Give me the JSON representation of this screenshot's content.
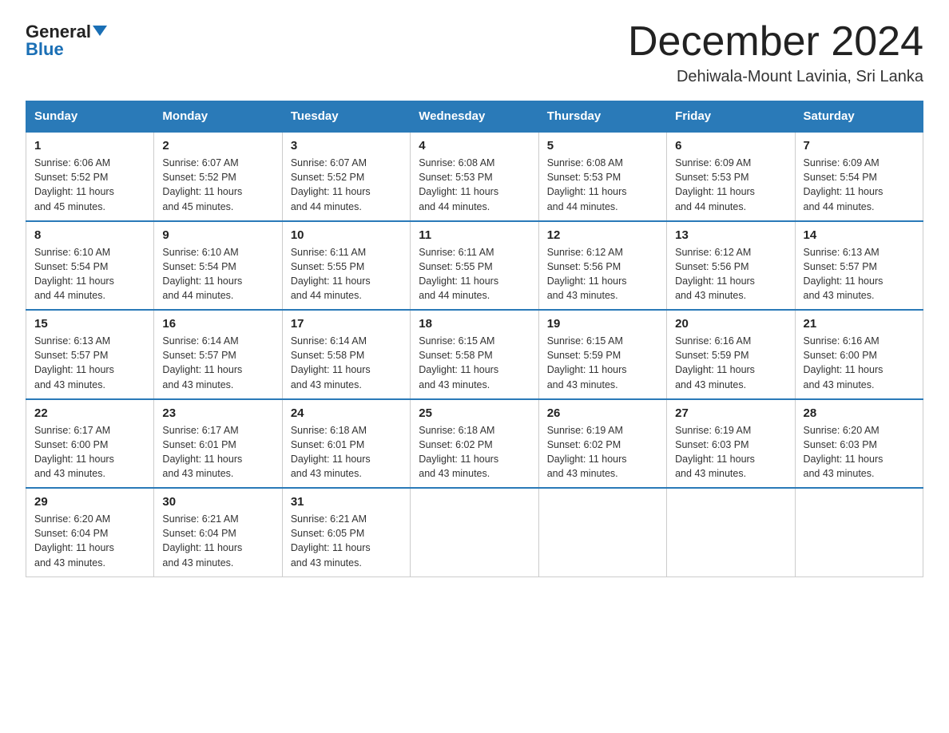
{
  "logo": {
    "text_general": "General",
    "text_blue": "Blue"
  },
  "title": {
    "month_year": "December 2024",
    "location": "Dehiwala-Mount Lavinia, Sri Lanka"
  },
  "days_of_week": [
    "Sunday",
    "Monday",
    "Tuesday",
    "Wednesday",
    "Thursday",
    "Friday",
    "Saturday"
  ],
  "weeks": [
    [
      {
        "day": "1",
        "sunrise": "6:06 AM",
        "sunset": "5:52 PM",
        "daylight": "11 hours and 45 minutes."
      },
      {
        "day": "2",
        "sunrise": "6:07 AM",
        "sunset": "5:52 PM",
        "daylight": "11 hours and 45 minutes."
      },
      {
        "day": "3",
        "sunrise": "6:07 AM",
        "sunset": "5:52 PM",
        "daylight": "11 hours and 44 minutes."
      },
      {
        "day": "4",
        "sunrise": "6:08 AM",
        "sunset": "5:53 PM",
        "daylight": "11 hours and 44 minutes."
      },
      {
        "day": "5",
        "sunrise": "6:08 AM",
        "sunset": "5:53 PM",
        "daylight": "11 hours and 44 minutes."
      },
      {
        "day": "6",
        "sunrise": "6:09 AM",
        "sunset": "5:53 PM",
        "daylight": "11 hours and 44 minutes."
      },
      {
        "day": "7",
        "sunrise": "6:09 AM",
        "sunset": "5:54 PM",
        "daylight": "11 hours and 44 minutes."
      }
    ],
    [
      {
        "day": "8",
        "sunrise": "6:10 AM",
        "sunset": "5:54 PM",
        "daylight": "11 hours and 44 minutes."
      },
      {
        "day": "9",
        "sunrise": "6:10 AM",
        "sunset": "5:54 PM",
        "daylight": "11 hours and 44 minutes."
      },
      {
        "day": "10",
        "sunrise": "6:11 AM",
        "sunset": "5:55 PM",
        "daylight": "11 hours and 44 minutes."
      },
      {
        "day": "11",
        "sunrise": "6:11 AM",
        "sunset": "5:55 PM",
        "daylight": "11 hours and 44 minutes."
      },
      {
        "day": "12",
        "sunrise": "6:12 AM",
        "sunset": "5:56 PM",
        "daylight": "11 hours and 43 minutes."
      },
      {
        "day": "13",
        "sunrise": "6:12 AM",
        "sunset": "5:56 PM",
        "daylight": "11 hours and 43 minutes."
      },
      {
        "day": "14",
        "sunrise": "6:13 AM",
        "sunset": "5:57 PM",
        "daylight": "11 hours and 43 minutes."
      }
    ],
    [
      {
        "day": "15",
        "sunrise": "6:13 AM",
        "sunset": "5:57 PM",
        "daylight": "11 hours and 43 minutes."
      },
      {
        "day": "16",
        "sunrise": "6:14 AM",
        "sunset": "5:57 PM",
        "daylight": "11 hours and 43 minutes."
      },
      {
        "day": "17",
        "sunrise": "6:14 AM",
        "sunset": "5:58 PM",
        "daylight": "11 hours and 43 minutes."
      },
      {
        "day": "18",
        "sunrise": "6:15 AM",
        "sunset": "5:58 PM",
        "daylight": "11 hours and 43 minutes."
      },
      {
        "day": "19",
        "sunrise": "6:15 AM",
        "sunset": "5:59 PM",
        "daylight": "11 hours and 43 minutes."
      },
      {
        "day": "20",
        "sunrise": "6:16 AM",
        "sunset": "5:59 PM",
        "daylight": "11 hours and 43 minutes."
      },
      {
        "day": "21",
        "sunrise": "6:16 AM",
        "sunset": "6:00 PM",
        "daylight": "11 hours and 43 minutes."
      }
    ],
    [
      {
        "day": "22",
        "sunrise": "6:17 AM",
        "sunset": "6:00 PM",
        "daylight": "11 hours and 43 minutes."
      },
      {
        "day": "23",
        "sunrise": "6:17 AM",
        "sunset": "6:01 PM",
        "daylight": "11 hours and 43 minutes."
      },
      {
        "day": "24",
        "sunrise": "6:18 AM",
        "sunset": "6:01 PM",
        "daylight": "11 hours and 43 minutes."
      },
      {
        "day": "25",
        "sunrise": "6:18 AM",
        "sunset": "6:02 PM",
        "daylight": "11 hours and 43 minutes."
      },
      {
        "day": "26",
        "sunrise": "6:19 AM",
        "sunset": "6:02 PM",
        "daylight": "11 hours and 43 minutes."
      },
      {
        "day": "27",
        "sunrise": "6:19 AM",
        "sunset": "6:03 PM",
        "daylight": "11 hours and 43 minutes."
      },
      {
        "day": "28",
        "sunrise": "6:20 AM",
        "sunset": "6:03 PM",
        "daylight": "11 hours and 43 minutes."
      }
    ],
    [
      {
        "day": "29",
        "sunrise": "6:20 AM",
        "sunset": "6:04 PM",
        "daylight": "11 hours and 43 minutes."
      },
      {
        "day": "30",
        "sunrise": "6:21 AM",
        "sunset": "6:04 PM",
        "daylight": "11 hours and 43 minutes."
      },
      {
        "day": "31",
        "sunrise": "6:21 AM",
        "sunset": "6:05 PM",
        "daylight": "11 hours and 43 minutes."
      },
      null,
      null,
      null,
      null
    ]
  ],
  "labels": {
    "sunrise": "Sunrise:",
    "sunset": "Sunset:",
    "daylight": "Daylight:"
  }
}
